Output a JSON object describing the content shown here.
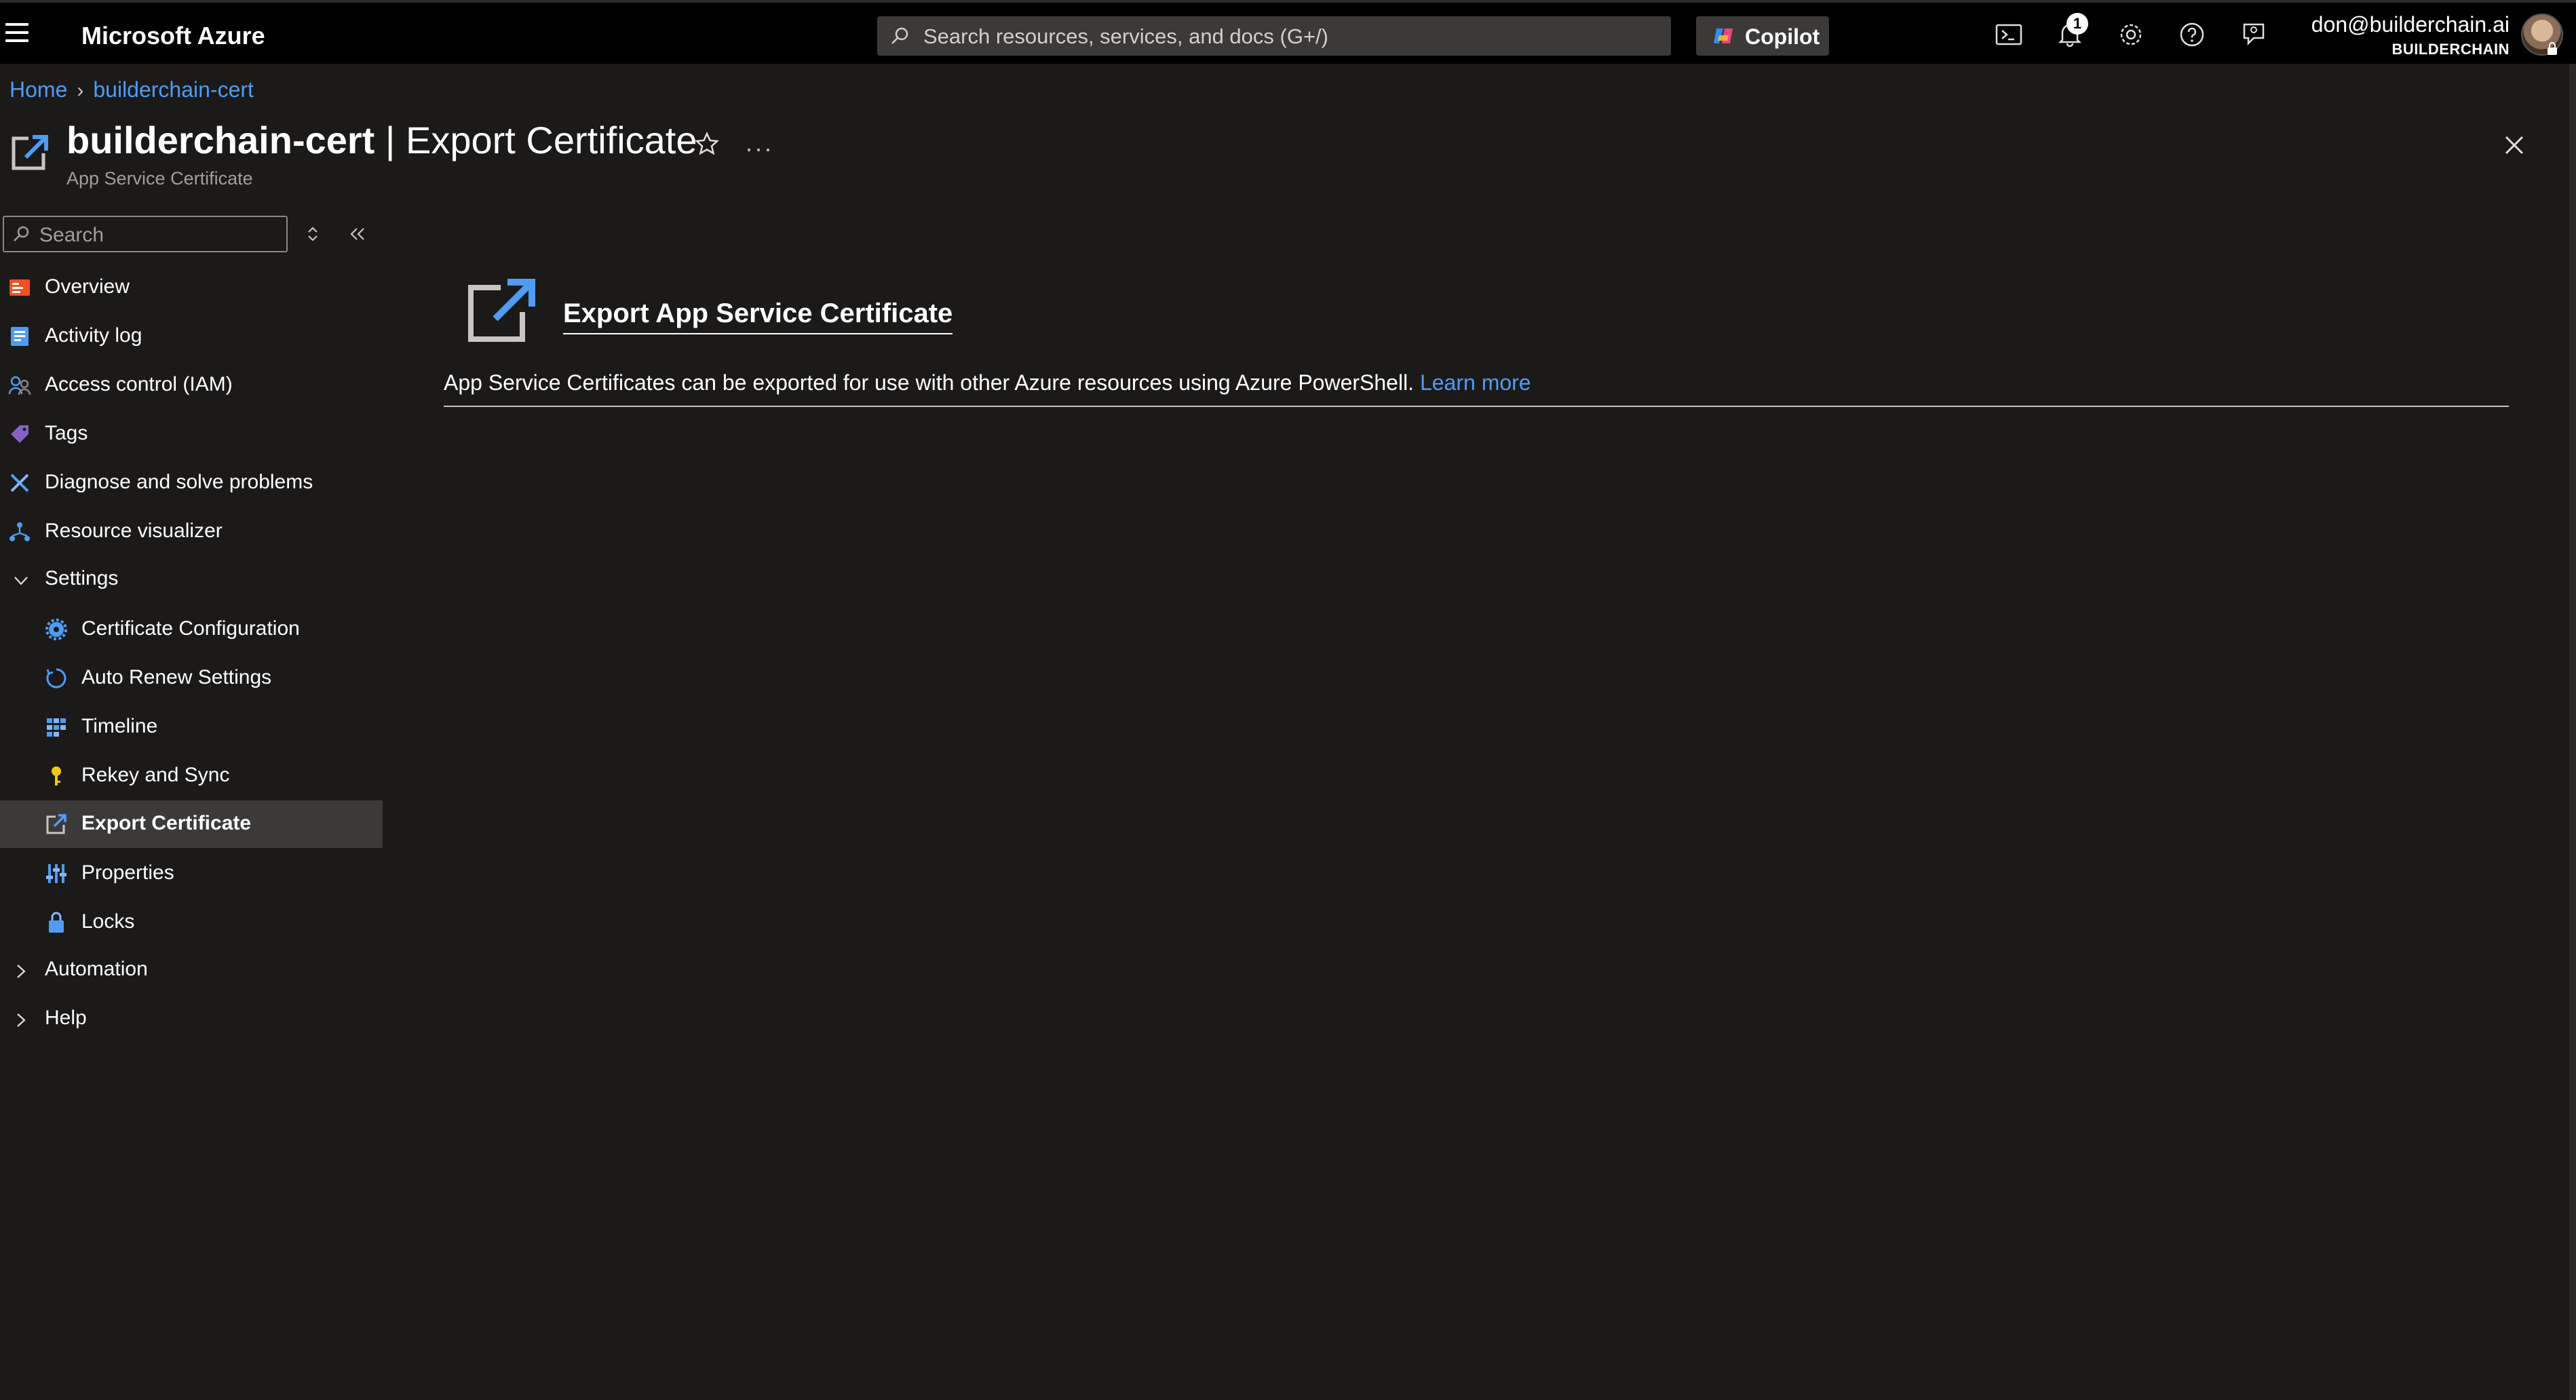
{
  "topbar": {
    "brand": "Microsoft Azure",
    "search_placeholder": "Search resources, services, and docs (G+/)",
    "copilot_label": "Copilot",
    "notifications_count": "1",
    "user_email": "don@builderchain.ai",
    "user_tenant": "BUILDERCHAIN",
    "icons": [
      "menu-icon",
      "cloud-shell-icon",
      "notifications-icon",
      "settings-icon",
      "help-icon",
      "feedback-icon"
    ]
  },
  "breadcrumb": {
    "home": "Home",
    "resource": "builderchain-cert"
  },
  "header": {
    "resource_name": "builderchain-cert",
    "separator": " | ",
    "blade_title": "Export Certificate",
    "subtitle": "App Service Certificate",
    "more": "···"
  },
  "sidebar": {
    "search_placeholder": "Search",
    "items": [
      {
        "label": "Overview",
        "icon": "overview-icon"
      },
      {
        "label": "Activity log",
        "icon": "activity-log-icon"
      },
      {
        "label": "Access control (IAM)",
        "icon": "iam-icon"
      },
      {
        "label": "Tags",
        "icon": "tag-icon"
      },
      {
        "label": "Diagnose and solve problems",
        "icon": "diagnose-icon"
      },
      {
        "label": "Resource visualizer",
        "icon": "visualizer-icon"
      }
    ],
    "settings": {
      "label": "Settings",
      "expanded": true,
      "items": [
        {
          "label": "Certificate Configuration",
          "icon": "gear-icon"
        },
        {
          "label": "Auto Renew Settings",
          "icon": "renew-icon"
        },
        {
          "label": "Timeline",
          "icon": "timeline-icon"
        },
        {
          "label": "Rekey and Sync",
          "icon": "key-icon"
        },
        {
          "label": "Export Certificate",
          "icon": "export-icon",
          "selected": true
        },
        {
          "label": "Properties",
          "icon": "properties-icon"
        },
        {
          "label": "Locks",
          "icon": "lock-icon"
        }
      ]
    },
    "automation": {
      "label": "Automation"
    },
    "help": {
      "label": "Help"
    }
  },
  "main": {
    "heading": "Export App Service Certificate",
    "description": "App Service Certificates can be exported for use with other Azure resources using Azure PowerShell.",
    "learn_more": "Learn more"
  },
  "colors": {
    "background": "#1b1a19",
    "topbar": "#000000",
    "link": "#4f9cf5",
    "selected_row": "#3b3a39"
  }
}
